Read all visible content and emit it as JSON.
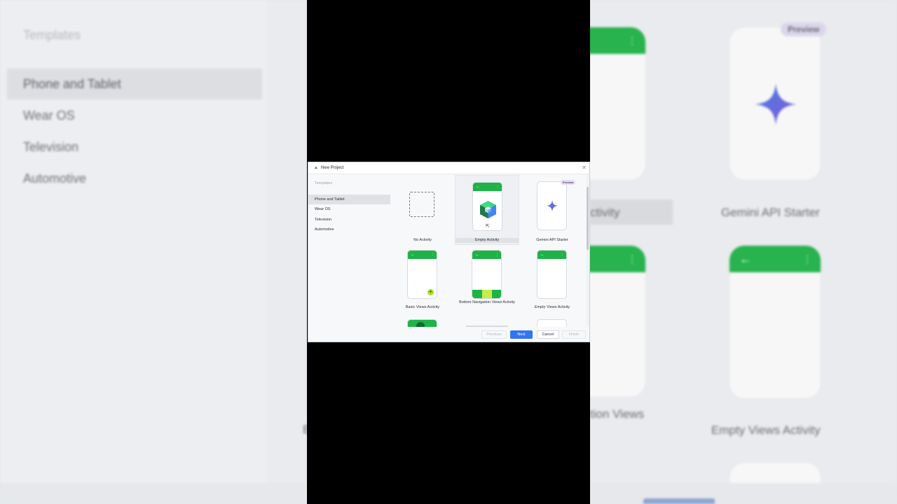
{
  "window": {
    "title": "New Project",
    "close_glyph": "✕"
  },
  "sidebar": {
    "heading": "Templates",
    "items": [
      {
        "label": "Phone and Tablet",
        "selected": true
      },
      {
        "label": "Wear OS"
      },
      {
        "label": "Television"
      },
      {
        "label": "Automotive"
      }
    ]
  },
  "templates": [
    {
      "label": "No Activity"
    },
    {
      "label": "Empty Activity",
      "selected": true
    },
    {
      "label": "Gemini API Starter",
      "badge": "Preview"
    },
    {
      "label": "Basic Views Activity"
    },
    {
      "label": "Bottom Navigation Views Activity"
    },
    {
      "label": "Empty Views Activity"
    }
  ],
  "phone_glyphs": {
    "back": "←",
    "kebab": "⋮",
    "fab_plus": "+"
  },
  "buttons": {
    "previous": "Previous",
    "next": "Next",
    "cancel": "Cancel",
    "finish": "Finish"
  },
  "background_zoom": {
    "heading": "Templates",
    "items": [
      "Phone and Tablet",
      "Wear OS",
      "Television",
      "Automotive"
    ],
    "labels": [
      "Gemini API Starter",
      "Empty Views Activity"
    ],
    "label_fragments": [
      "ctivity",
      "tion Views",
      "B"
    ],
    "preview_badge": "Preview",
    "back_glyph": "←",
    "kebab_glyph": "⋮"
  },
  "colors": {
    "accent": "#3574f0",
    "template_green": "#1fb347",
    "fab_lime": "#a6e21b",
    "preview_badge_bg": "#e4dcf4"
  }
}
